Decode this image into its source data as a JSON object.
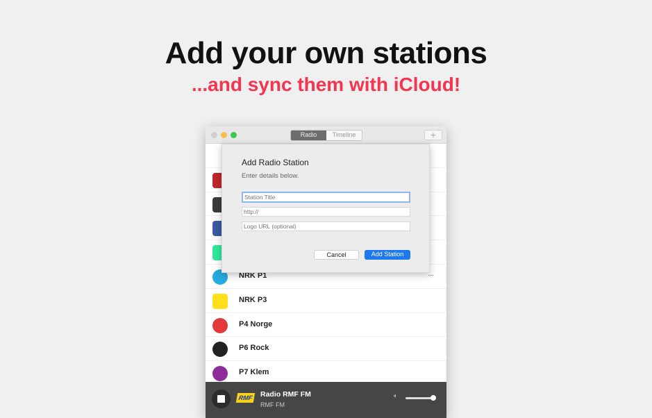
{
  "headline": "Add your own stations",
  "subheadline": "...and sync them with iCloud!",
  "window": {
    "tabs": [
      {
        "label": "Radio",
        "active": true
      },
      {
        "label": "Timeline",
        "active": false
      }
    ],
    "add_icon": "plus-icon"
  },
  "stations": [
    {
      "name": "",
      "logo_color": "#ffffff"
    },
    {
      "name": "",
      "logo_color": "#c0262c"
    },
    {
      "name": "",
      "logo_color": "#3a3a3a"
    },
    {
      "name": "",
      "logo_color": "#3b5aa0"
    },
    {
      "name": "",
      "logo_color": "#2ee89a"
    },
    {
      "name": "NRK P1",
      "logo_color": "#27a9e1",
      "more": "..."
    },
    {
      "name": "NRK P3",
      "logo_color": "#ffe01a"
    },
    {
      "name": "P4 Norge",
      "logo_color": "#e23a3a"
    },
    {
      "name": "P6 Rock",
      "logo_color": "#222222"
    },
    {
      "name": "P7 Klem",
      "logo_color": "#8e2d9a"
    }
  ],
  "player": {
    "title": "Radio RMF FM",
    "subtitle": "RMF FM",
    "logo_text": "RMF",
    "volume": 0.9
  },
  "dialog": {
    "title": "Add Radio Station",
    "subtitle": "Enter details below.",
    "fields": [
      {
        "placeholder": "Station Title",
        "value": ""
      },
      {
        "placeholder": "http://",
        "value": ""
      },
      {
        "placeholder": "Logo URL (optional)",
        "value": ""
      }
    ],
    "cancel": "Cancel",
    "submit": "Add Station"
  },
  "colors": {
    "accent": "#f5344f",
    "button": "#1e78f0"
  }
}
